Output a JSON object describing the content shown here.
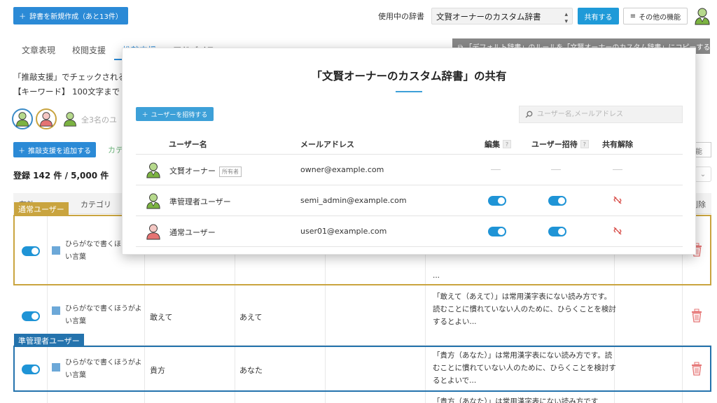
{
  "header": {
    "new_dictionary_label": "辞書を新規作成（あと13件）",
    "dictionary_in_use_label": "使用中の辞書",
    "selected_dictionary": "文賢オーナーのカスタム辞書",
    "share_label": "共有する",
    "more_label": "その他の機能"
  },
  "tabs": [
    {
      "label": "文章表現"
    },
    {
      "label": "校閲支援"
    },
    {
      "label": "推敲支援"
    },
    {
      "label": "アドバイス"
    }
  ],
  "copy_banner": "「デフォルト辞書」のルールを「文賢オーナーのカスタム辞書」にコピーする",
  "description": {
    "line1": "「推敲支援」でチェックされる",
    "line2": "【キーワード】 100文字まで"
  },
  "members_summary": "全3名のユ",
  "add_rule_label": "推敲支援を追加する",
  "category_link": "カテ",
  "right_stub": "能",
  "registered_count": "登録 142 件 / 5,000 件",
  "table_headers": {
    "enabled": "有効",
    "category": "カテゴリ",
    "delete": "削除"
  },
  "rows": [
    {
      "category": "ひらがなで書くほうがよい言葉",
      "word": "",
      "reading": "",
      "message": "..."
    },
    {
      "category": "ひらがなで書くほうがよい言葉",
      "word": "敢えて",
      "reading": "あえて",
      "message": "「敢えて（あえて）」は常用漢字表にない読み方です。読むことに慣れていない人のために、ひらくことを検討するとよい..."
    },
    {
      "category": "ひらがなで書くほうがよい言葉",
      "word": "貴方",
      "reading": "あなた",
      "message": "「貴方（あなた）」は常用漢字表にない読み方です。読むことに慣れていない人のために、ひらくことを検討するとよいで..."
    },
    {
      "category": "",
      "word": "",
      "reading": "",
      "message": "「貴方（あなた）」は常用漢字表にない読み方です"
    }
  ],
  "annotations": {
    "normal_user_tag": "通常ユーザー",
    "semi_admin_tag": "準管理者ユーザー",
    "normal_color": "#c9a43f",
    "semi_admin_color": "#2473ad"
  },
  "modal": {
    "title": "「文賢オーナーのカスタム辞書」の共有",
    "invite_label": "ユーザーを招待する",
    "search_placeholder": "ユーザー名,メールアドレス",
    "columns": {
      "username": "ユーザー名",
      "email": "メールアドレス",
      "edit": "編集",
      "invite": "ユーザー招待",
      "unshare": "共有解除",
      "help": "?"
    },
    "users": [
      {
        "name": "文賢オーナー",
        "badge": "所有者",
        "email": "owner@example.com",
        "edit": null,
        "invite": null,
        "unshare": null,
        "avatar_color": "#7cb342"
      },
      {
        "name": "準管理者ユーザー",
        "badge": "",
        "email": "semi_admin@example.com",
        "edit": true,
        "invite": true,
        "unshare": true,
        "avatar_color": "#7cb342"
      },
      {
        "name": "通常ユーザー",
        "badge": "",
        "email": "user01@example.com",
        "edit": true,
        "invite": true,
        "unshare": true,
        "avatar_color": "#e57373"
      }
    ]
  },
  "colors": {
    "primary": "#2b8ad6",
    "toggle_on": "#1f94d6",
    "unshare_icon": "#d9534f",
    "trash_icon": "#e57373"
  }
}
